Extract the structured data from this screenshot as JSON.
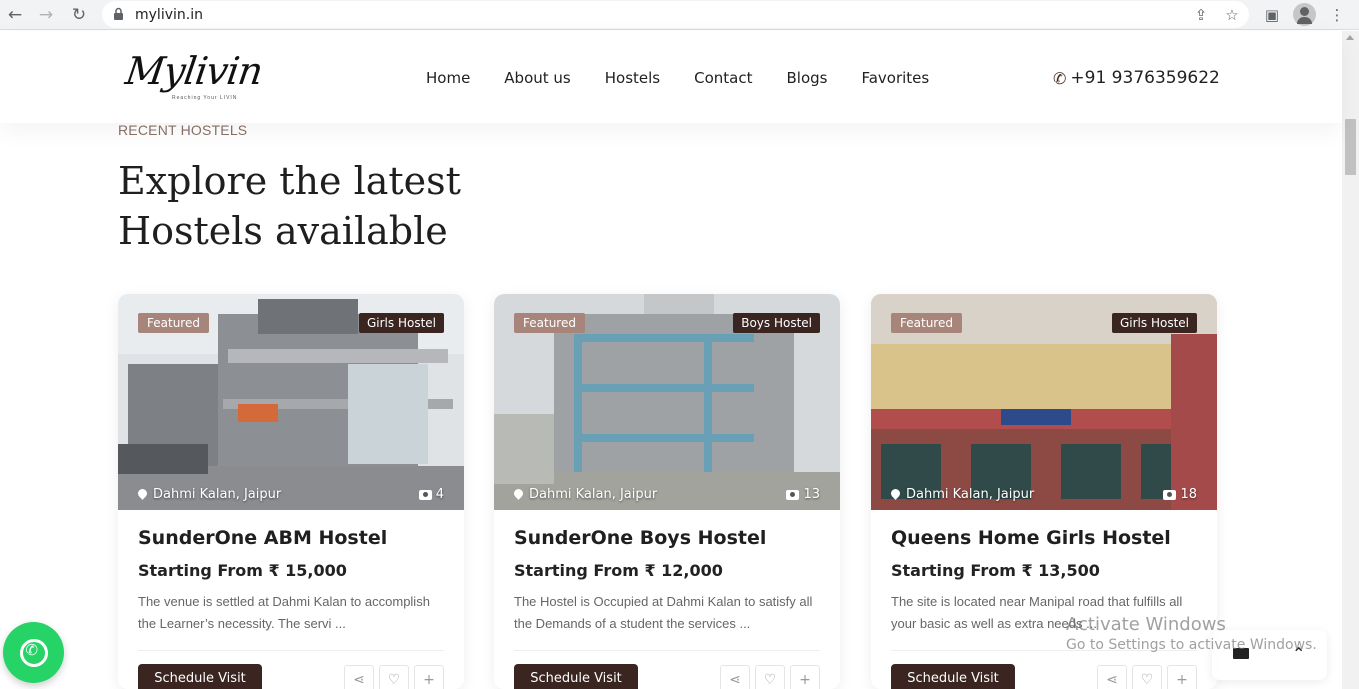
{
  "browser": {
    "url": "mylivin.in",
    "icons": [
      "back-icon",
      "forward-icon",
      "reload-icon",
      "lock-icon",
      "share-icon",
      "star-icon",
      "sidepanel-icon",
      "profile-icon",
      "menu-icon"
    ]
  },
  "header": {
    "logo_text": "Mylivin",
    "logo_tagline": "Reaching Your LIVIN",
    "nav": [
      "Home",
      "About us",
      "Hostels",
      "Contact",
      "Blogs",
      "Favorites"
    ],
    "phone": "+91 9376359622"
  },
  "section": {
    "kicker": "RECENT HOSTELS",
    "headline_line1": "Explore the latest",
    "headline_line2": "Hostels available"
  },
  "cards": [
    {
      "featured": "Featured",
      "type": "Girls Hostel",
      "location": "Dahmi Kalan, Jaipur",
      "photo_count": "4",
      "title": "SunderOne ABM Hostel",
      "price_label": "Starting From",
      "price": "₹ 15,000",
      "description": "The venue is settled at Dahmi Kalan to accomplish the Learner’s necessity. The servi ...",
      "button": "Schedule Visit"
    },
    {
      "featured": "Featured",
      "type": "Boys Hostel",
      "location": "Dahmi Kalan, Jaipur",
      "photo_count": "13",
      "title": "SunderOne Boys Hostel",
      "price_label": "Starting From",
      "price": "₹ 12,000",
      "description": "The Hostel is Occupied at Dahmi Kalan to satisfy all the Demands of a student the services ...",
      "button": "Schedule Visit"
    },
    {
      "featured": "Featured",
      "type": "Girls Hostel",
      "location": "Dahmi Kalan, Jaipur",
      "photo_count": "18",
      "title": "Queens Home Girls Hostel",
      "price_label": "Starting From",
      "price": "₹ 13,500",
      "description": "The site is located near Manipal road that fulfills all your basic as well as extra needs ...",
      "button": "Schedule Visit"
    }
  ],
  "overlay": {
    "activate_title": "Activate Windows",
    "activate_sub": "Go to Settings to activate Windows."
  },
  "colors": {
    "brand_dark": "#3a2521",
    "featured_badge": "#a7857a",
    "whatsapp": "#25d366"
  }
}
